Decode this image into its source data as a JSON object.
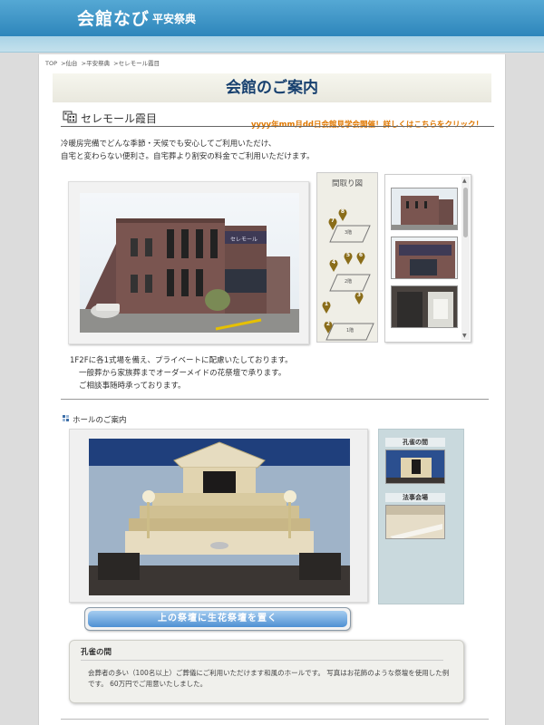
{
  "header": {
    "logo": "会館なび",
    "subtitle": "平安祭典"
  },
  "breadcrumb": {
    "items": [
      "TOP",
      ">仙台",
      ">平安祭典",
      ">セレモール霞目"
    ]
  },
  "page_title": "会館のご案内",
  "hall": {
    "name": "セレモール霞目",
    "promo_link": "yyyy年mm月dd日会館見学会開催！詳しくはこちらをクリック！",
    "intro_lines": [
      "冷暖房完備でどんな季節・天候でも安心してご利用いただけ、",
      "自宅と変わらない便利さ。自宅葬より割安の料金でご利用いただけます。"
    ]
  },
  "floor_map": {
    "label": "間取り図",
    "floors": [
      "3階",
      "2階",
      "1階"
    ],
    "pins": [
      "7",
      "8",
      "4",
      "5",
      "6",
      "1",
      "2",
      "3"
    ]
  },
  "features": [
    "1F2Fに各1式場を備え、プライベートに配慮いたしております。",
    "一般葬から家族葬までオーダーメイドの花祭壇で承ります。",
    "ご相談事随時承っております。"
  ],
  "hall_section": {
    "title": "ホールのご案内",
    "side_items": [
      {
        "label": "孔雀の間"
      },
      {
        "label": "法事会場"
      }
    ],
    "flower_button": "上の祭壇に生花祭壇を置く"
  },
  "description": {
    "title": "孔雀の間",
    "text": "会葬者の多い（100名以上）ご葬儀にご利用いただけます和風のホールです。 写真はお花飾のような祭壇を使用した例です。 60万円でご用意いたしました。"
  },
  "colors": {
    "header_blue": "#2e86bb",
    "title_navy": "#17406f",
    "promo_orange": "#e07800",
    "button_blue": "#4f90d3"
  }
}
